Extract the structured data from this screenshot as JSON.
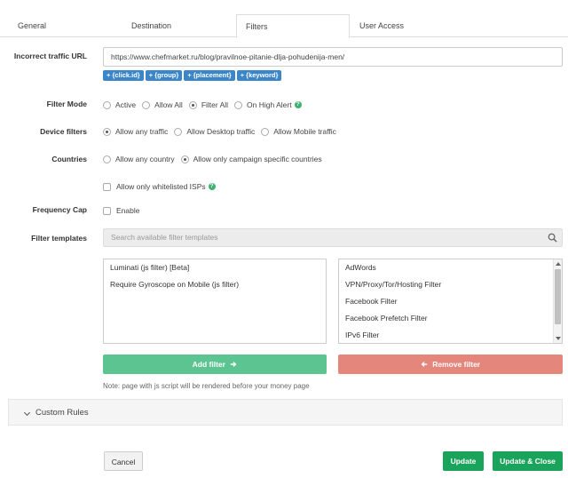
{
  "tabs": [
    {
      "label": "General"
    },
    {
      "label": "Destination"
    },
    {
      "label": "Filters"
    },
    {
      "label": "User Access"
    }
  ],
  "incorrect_traffic": {
    "label": "Incorrect traffic URL",
    "value": "https://www.chefmarket.ru/blog/pravilnoe-pitanie-dlja-pohudenija-men/",
    "tokens": [
      "+ {click.id}",
      "+ {group}",
      "+ {placement}",
      "+ {keyword}"
    ]
  },
  "filter_mode": {
    "label": "Filter Mode",
    "options": [
      "Active",
      "Allow All",
      "Filter All",
      "On High Alert"
    ],
    "selected": "Filter All"
  },
  "device_filters": {
    "label": "Device filters",
    "options": [
      "Allow any traffic",
      "Allow Desktop traffic",
      "Allow Mobile traffic"
    ],
    "selected": "Allow any traffic"
  },
  "countries": {
    "label": "Countries",
    "options": [
      "Allow any country",
      "Allow only campaign specific countries"
    ],
    "selected": "Allow only campaign specific countries"
  },
  "whitelisted_isps": {
    "label": "Allow only whitelisted ISPs",
    "checked": false
  },
  "frequency_cap": {
    "label": "Frequency Cap",
    "checkbox_label": "Enable",
    "checked": false
  },
  "filter_templates": {
    "label": "Filter templates",
    "search_placeholder": "Search available filter templates",
    "selected": [
      "Luminati (js filter) [Beta]",
      "Require Gyroscope on Mobile (js filter)"
    ],
    "available": [
      "AdWords",
      "VPN/Proxy/Tor/Hosting Filter",
      "Facebook Filter",
      "Facebook Prefetch Filter",
      "IPv6 Filter"
    ],
    "add_label": "Add filter",
    "remove_label": "Remove filter",
    "note": "Note: page with js script will be rendered before your money page"
  },
  "custom_rules": {
    "label": "Custom Rules"
  },
  "footer": {
    "cancel_label": "Cancel",
    "update_label": "Update",
    "update_close_label": "Update & Close"
  },
  "colors": {
    "token_blue": "#3a86c8",
    "add_green": "#5bc491",
    "remove_red": "#e4867c",
    "update_green": "#1aa35a",
    "help_green": "#3cb371"
  }
}
